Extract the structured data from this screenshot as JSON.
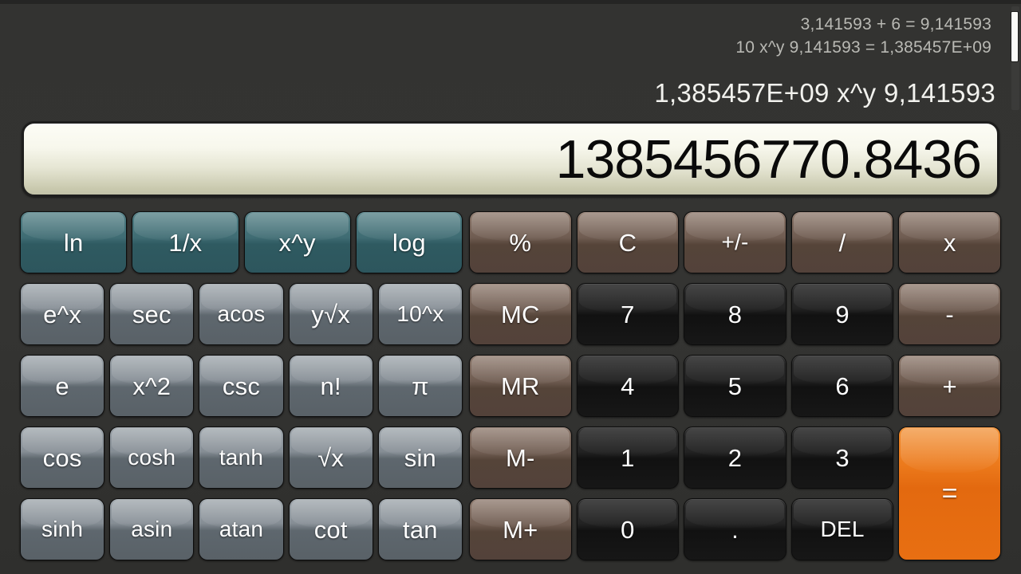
{
  "display": {
    "history": [
      "3,141593 + 6 = 9,141593",
      "10 x^y 9,141593 = 1,385457E+09"
    ],
    "expression": "1,385457E+09 x^y 9,141593",
    "value": "1385456770.8436"
  },
  "colors": {
    "background": "#333331",
    "sci_primary": "#3f6c73",
    "sci_secondary": "#868e95",
    "operator": "#6f5c51",
    "digit": "#1a1a1a",
    "equals": "#ec7a1c",
    "display_text": "#0a0a0a",
    "history_text": "#b9b9b4"
  },
  "keypad": {
    "rows": [
      {
        "sci": [
          {
            "label": "ln",
            "name": "ln",
            "style": "k-teal"
          },
          {
            "label": "1/x",
            "name": "reciprocal",
            "style": "k-teal"
          },
          {
            "label": "x^y",
            "name": "power",
            "style": "k-teal"
          },
          {
            "label": "log",
            "name": "log",
            "style": "k-teal"
          }
        ],
        "main": [
          {
            "label": "%",
            "name": "percent",
            "style": "k-brown"
          },
          {
            "label": "C",
            "name": "clear",
            "style": "k-brown"
          },
          {
            "label": "+/-",
            "name": "sign-toggle",
            "style": "k-brown"
          },
          {
            "label": "/",
            "name": "divide",
            "style": "k-brown"
          },
          {
            "label": "x",
            "name": "multiply",
            "style": "k-brown"
          }
        ]
      },
      {
        "sci": [
          {
            "label": "e^x",
            "name": "exp",
            "style": "k-gray"
          },
          {
            "label": "sec",
            "name": "sec",
            "style": "k-gray"
          },
          {
            "label": "acos",
            "name": "acos",
            "style": "k-gray"
          },
          {
            "label": "y√x",
            "name": "nth-root",
            "style": "k-gray"
          },
          {
            "label": "10^x",
            "name": "ten-power",
            "style": "k-gray"
          }
        ],
        "main": [
          {
            "label": "MC",
            "name": "memory-clear",
            "style": "k-brown"
          },
          {
            "label": "7",
            "name": "digit-7",
            "style": "k-dark"
          },
          {
            "label": "8",
            "name": "digit-8",
            "style": "k-dark"
          },
          {
            "label": "9",
            "name": "digit-9",
            "style": "k-dark"
          },
          {
            "label": "-",
            "name": "subtract",
            "style": "k-brown"
          }
        ]
      },
      {
        "sci": [
          {
            "label": "e",
            "name": "euler",
            "style": "k-gray"
          },
          {
            "label": "x^2",
            "name": "square",
            "style": "k-gray"
          },
          {
            "label": "csc",
            "name": "csc",
            "style": "k-gray"
          },
          {
            "label": "n!",
            "name": "factorial",
            "style": "k-gray"
          },
          {
            "label": "π",
            "name": "pi",
            "style": "k-gray"
          }
        ],
        "main": [
          {
            "label": "MR",
            "name": "memory-recall",
            "style": "k-brown"
          },
          {
            "label": "4",
            "name": "digit-4",
            "style": "k-dark"
          },
          {
            "label": "5",
            "name": "digit-5",
            "style": "k-dark"
          },
          {
            "label": "6",
            "name": "digit-6",
            "style": "k-dark"
          },
          {
            "label": "+",
            "name": "add",
            "style": "k-brown"
          }
        ]
      },
      {
        "sci": [
          {
            "label": "cos",
            "name": "cos",
            "style": "k-gray"
          },
          {
            "label": "cosh",
            "name": "cosh",
            "style": "k-gray"
          },
          {
            "label": "tanh",
            "name": "tanh",
            "style": "k-gray"
          },
          {
            "label": "√x",
            "name": "sqrt",
            "style": "k-gray"
          },
          {
            "label": "sin",
            "name": "sin",
            "style": "k-gray"
          }
        ],
        "main": [
          {
            "label": "M-",
            "name": "memory-subtract",
            "style": "k-brown"
          },
          {
            "label": "1",
            "name": "digit-1",
            "style": "k-dark"
          },
          {
            "label": "2",
            "name": "digit-2",
            "style": "k-dark"
          },
          {
            "label": "3",
            "name": "digit-3",
            "style": "k-dark"
          }
        ]
      },
      {
        "sci": [
          {
            "label": "sinh",
            "name": "sinh",
            "style": "k-gray"
          },
          {
            "label": "asin",
            "name": "asin",
            "style": "k-gray"
          },
          {
            "label": "atan",
            "name": "atan",
            "style": "k-gray"
          },
          {
            "label": "cot",
            "name": "cot",
            "style": "k-gray"
          },
          {
            "label": "tan",
            "name": "tan",
            "style": "k-gray"
          }
        ],
        "main": [
          {
            "label": "M+",
            "name": "memory-add",
            "style": "k-brown"
          },
          {
            "label": "0",
            "name": "digit-0",
            "style": "k-dark"
          },
          {
            "label": ".",
            "name": "decimal",
            "style": "k-dark"
          },
          {
            "label": "DEL",
            "name": "delete",
            "style": "k-dark"
          }
        ]
      }
    ],
    "equals": {
      "label": "=",
      "name": "equals",
      "style": "k-orange"
    }
  }
}
